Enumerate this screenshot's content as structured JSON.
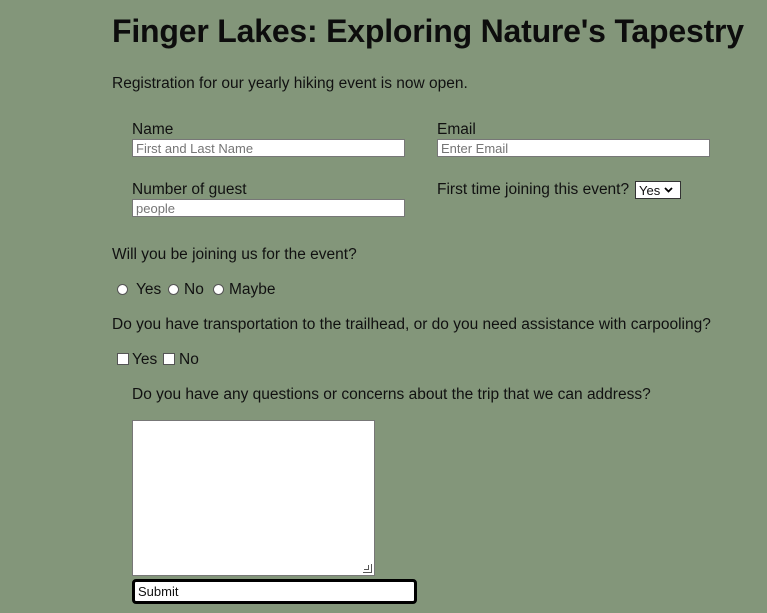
{
  "title": "Finger Lakes: Exploring Nature's Tapestry",
  "intro": "Registration for our yearly hiking event is now open.",
  "form": {
    "name_label": "Name",
    "name_placeholder": "First and Last Name",
    "email_label": "Email",
    "email_placeholder": "Enter Email",
    "guests_label": "Number of guest",
    "guests_placeholder": "people",
    "first_time_label": "First time joining this event?",
    "first_time_value": "Yes",
    "attend_question": "Will you be joining us for the event?",
    "attend_options": [
      "Yes",
      "No",
      "Maybe"
    ],
    "transport_question": "Do you have transportation to the trailhead, or do you need assistance with carpooling?",
    "transport_options": [
      "Yes",
      "No"
    ],
    "questions_label": "Do you have any questions or concerns about the trip that we can address?",
    "submit_label": "Submit"
  }
}
